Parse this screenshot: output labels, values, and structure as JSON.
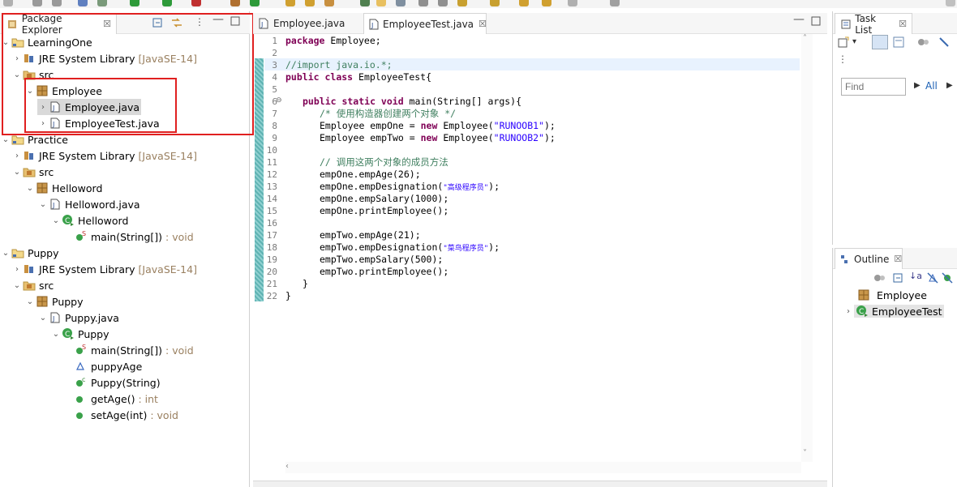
{
  "package_explorer": {
    "tab_label": "Package Explorer",
    "tree": [
      {
        "label": "LearningOne",
        "suffix": ""
      },
      {
        "label": "JRE System Library",
        "suffix": "[JavaSE-14]"
      },
      {
        "label": "src",
        "suffix": ""
      },
      {
        "label": "Employee",
        "suffix": ""
      },
      {
        "label": "Employee.java",
        "suffix": ""
      },
      {
        "label": "EmployeeTest.java",
        "suffix": ""
      },
      {
        "label": "Practice",
        "suffix": ""
      },
      {
        "label": "JRE System Library",
        "suffix": "[JavaSE-14]"
      },
      {
        "label": "src",
        "suffix": ""
      },
      {
        "label": "Helloword",
        "suffix": ""
      },
      {
        "label": "Helloword.java",
        "suffix": ""
      },
      {
        "label": "Helloword",
        "suffix": ""
      },
      {
        "label": "main(String[])",
        "suffix": ": void"
      },
      {
        "label": "Puppy",
        "suffix": ""
      },
      {
        "label": "JRE System Library",
        "suffix": "[JavaSE-14]"
      },
      {
        "label": "src",
        "suffix": ""
      },
      {
        "label": "Puppy",
        "suffix": ""
      },
      {
        "label": "Puppy.java",
        "suffix": ""
      },
      {
        "label": "Puppy",
        "suffix": ""
      },
      {
        "label": "main(String[])",
        "suffix": ": void"
      },
      {
        "label": "puppyAge",
        "suffix": ""
      },
      {
        "label": "Puppy(String)",
        "suffix": ""
      },
      {
        "label": "getAge()",
        "suffix": ": int"
      },
      {
        "label": "setAge(int)",
        "suffix": ": void"
      }
    ]
  },
  "editor": {
    "tabs": [
      {
        "label": "Employee.java"
      },
      {
        "label": "EmployeeTest.java"
      }
    ],
    "line_numbers": [
      "1",
      "2",
      "3",
      "4",
      "5",
      "6",
      "7",
      "8",
      "9",
      "10",
      "11",
      "12",
      "13",
      "14",
      "15",
      "16",
      "17",
      "18",
      "19",
      "20",
      "21",
      "22"
    ],
    "lines": {
      "l1_kw": "package",
      "l1_rest": " Employee;",
      "l3": "//import java.io.*;",
      "l4_kw1": "public",
      "l4_kw2": " class",
      "l4_rest": " EmployeeTest{",
      "l6_kw": "public static void",
      "l6_rest": " main(String[] args){",
      "l7": "/* 使用构造器创建两个对象 */",
      "l8_a": "Employee empOne = ",
      "l8_kw": "new",
      "l8_b": " Employee(",
      "l8_str": "\"RUNOOB1\"",
      "l8_c": ");",
      "l9_a": "Employee empTwo = ",
      "l9_kw": "new",
      "l9_b": " Employee(",
      "l9_str": "\"RUNOOB2\"",
      "l9_c": ");",
      "l11": "// 调用这两个对象的成员方法",
      "l12": "empOne.empAge(26);",
      "l13_a": "empOne.empDesignation(",
      "l13_str": "\"高级程序员\"",
      "l13_b": ");",
      "l14": "empOne.empSalary(1000);",
      "l15": "empOne.printEmployee();",
      "l17": "empTwo.empAge(21);",
      "l18_a": "empTwo.empDesignation(",
      "l18_str": "\"菜鸟程序员\"",
      "l18_b": ");",
      "l19": "empTwo.empSalary(500);",
      "l20": "empTwo.printEmployee();",
      "l21": "}",
      "l22": "}"
    }
  },
  "task_list": {
    "tab_label": "Task List",
    "find_placeholder": "Find",
    "all_label": "All"
  },
  "outline": {
    "tab_label": "Outline",
    "items": [
      {
        "label": "Employee"
      },
      {
        "label": "EmployeeTest"
      }
    ]
  },
  "colors": {
    "keyword": "#7f0055",
    "comment": "#3f7f5f",
    "string": "#2a00ff",
    "highlight_box": "#e02020"
  }
}
